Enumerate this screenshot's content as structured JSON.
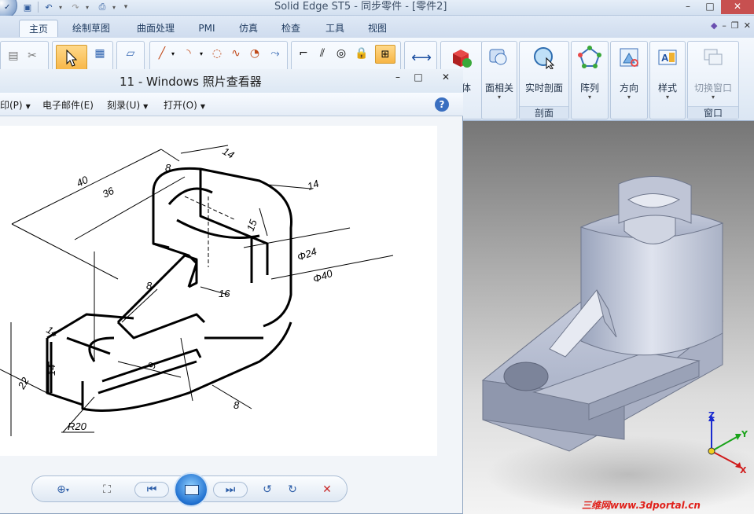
{
  "app": {
    "title": "Solid Edge ST5 - 同步零件 - [零件2]"
  },
  "ribbon": {
    "tabs": [
      "主页",
      "绘制草图",
      "曲面处理",
      "PMI",
      "仿真",
      "检查",
      "工具",
      "视图"
    ],
    "active_tab": "主页",
    "groups": [
      {
        "label": "体",
        "caption": ""
      },
      {
        "label": "面相关",
        "caption": ""
      },
      {
        "label": "实时剖面",
        "caption": "剖面"
      },
      {
        "label": "阵列",
        "caption": ""
      },
      {
        "label": "方向",
        "caption": ""
      },
      {
        "label": "样式",
        "caption": ""
      },
      {
        "label": "切换窗口",
        "caption": "窗口"
      }
    ]
  },
  "viewer": {
    "title": "11 - Windows 照片查看器",
    "menu": [
      "印(P)",
      "电子邮件(E)",
      "刻录(U)",
      "打开(O)"
    ],
    "help": "?"
  },
  "drawing": {
    "dims": [
      "40",
      "36",
      "8",
      "14",
      "14",
      "15",
      "Φ24",
      "Φ40",
      "8",
      "16",
      "14",
      "14",
      "22",
      "9",
      "R20",
      "8"
    ]
  },
  "viewport": {
    "axes": {
      "z": "Z",
      "y": "Y",
      "x": "X"
    },
    "axis_colors": {
      "z": "#1a2bd0",
      "y": "#1aa31a",
      "x": "#d01a1a"
    },
    "watermark": "三维网www.3dportal.cn"
  },
  "icons": {
    "save": "save-icon",
    "undo": "undo-icon",
    "redo": "redo-icon",
    "close": "close-icon",
    "select": "select-arrow-icon",
    "help": "help-icon"
  }
}
